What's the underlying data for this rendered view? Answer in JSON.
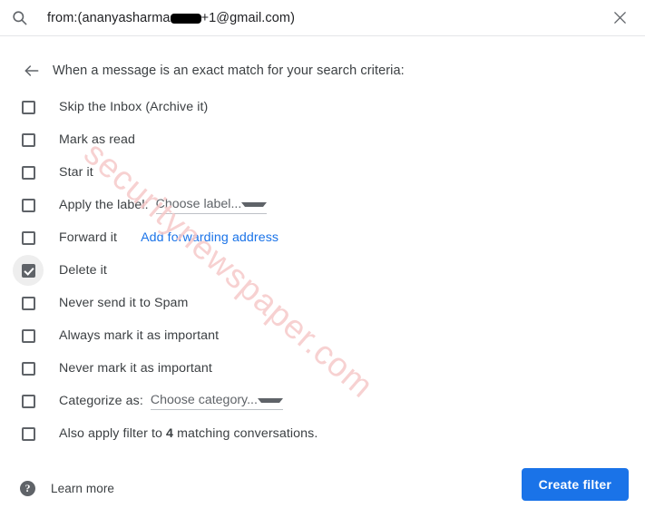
{
  "search": {
    "icon": "search-icon",
    "value_prefix": "from:(ananyasharma",
    "value_suffix": "+1@gmail.com)",
    "redacted": true,
    "close_icon": "close-icon"
  },
  "header": {
    "back_icon": "arrow-left-icon",
    "criteria_text": "When a message is an exact match for your search criteria:"
  },
  "options": [
    {
      "label": "Skip the Inbox (Archive it)",
      "checked": false,
      "name": "skip-inbox"
    },
    {
      "label": "Mark as read",
      "checked": false,
      "name": "mark-as-read"
    },
    {
      "label": "Star it",
      "checked": false,
      "name": "star-it"
    },
    {
      "label": "Apply the label:",
      "checked": false,
      "name": "apply-label",
      "dropdown": "Choose label..."
    },
    {
      "label": "Forward it",
      "checked": false,
      "name": "forward-it",
      "link": "Add forwarding address"
    },
    {
      "label": "Delete it",
      "checked": true,
      "name": "delete-it"
    },
    {
      "label": "Never send it to Spam",
      "checked": false,
      "name": "never-spam"
    },
    {
      "label": "Always mark it as important",
      "checked": false,
      "name": "always-important"
    },
    {
      "label": "Never mark it as important",
      "checked": false,
      "name": "never-important"
    },
    {
      "label": "Categorize as:",
      "checked": false,
      "name": "categorize-as",
      "dropdown": "Choose category..."
    },
    {
      "label_pre": "Also apply filter to ",
      "label_bold": "4",
      "label_post": " matching conversations.",
      "checked": false,
      "name": "also-apply-filter"
    }
  ],
  "footer": {
    "help_icon": "help-icon",
    "help_glyph": "?",
    "learn_more": "Learn more",
    "create_filter": "Create filter"
  },
  "watermark": {
    "text": "securitynewspaper.com"
  },
  "colors": {
    "accent_blue": "#1a73e8",
    "link_blue": "#1a73e8",
    "text_primary": "#3c4043",
    "text_secondary": "#5f6368",
    "checkbox_border": "#5f6368",
    "watermark": "#f6c9c9"
  }
}
